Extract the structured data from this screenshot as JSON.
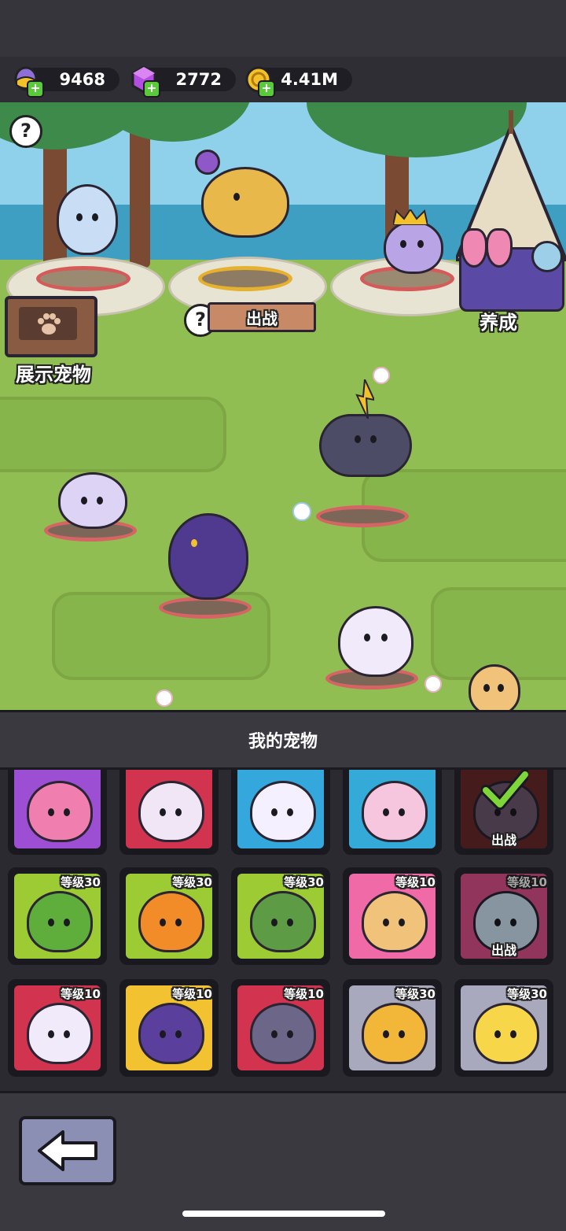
{
  "currencies": [
    {
      "name": "egg",
      "value": "9468",
      "icon": "egg-icon",
      "color": "#8e6fd8"
    },
    {
      "name": "gem",
      "value": "2772",
      "icon": "gem-icon",
      "color": "#b34ee0"
    },
    {
      "name": "coin",
      "value": "4.41M",
      "icon": "coin-icon",
      "color": "#f3c22b"
    }
  ],
  "scene": {
    "help_label": "?",
    "deploy_button": "出战",
    "display_pets_label": "展示宠物",
    "cultivate_label": "养成"
  },
  "panel": {
    "title": "我的宠物"
  },
  "pets": [
    {
      "bg": "#9c4fd3",
      "level": "",
      "deployed": false,
      "color": "#f07fb0"
    },
    {
      "bg": "#d2344f",
      "level": "",
      "deployed": false,
      "color": "#f0e6f5"
    },
    {
      "bg": "#34a7dc",
      "level": "",
      "deployed": false,
      "color": "#f5f0ff"
    },
    {
      "bg": "#33aad8",
      "level": "",
      "deployed": false,
      "color": "#f6c6de"
    },
    {
      "bg": "#6a2a2a",
      "level": "",
      "deployed": true,
      "color": "#6f5a70"
    },
    {
      "bg": "#9ccb34",
      "level": "等级30",
      "deployed": false,
      "color": "#5fae3b"
    },
    {
      "bg": "#9ccb34",
      "level": "等级30",
      "deployed": false,
      "color": "#f18c28"
    },
    {
      "bg": "#9ccb34",
      "level": "等级30",
      "deployed": false,
      "color": "#5e9b45"
    },
    {
      "bg": "#ef6aa6",
      "level": "等级10",
      "deployed": false,
      "color": "#f0c27a"
    },
    {
      "bg": "#e0528e",
      "level": "等级10",
      "deployed": true,
      "color": "#cfe5f8"
    },
    {
      "bg": "#d2344f",
      "level": "等级10",
      "deployed": false,
      "color": "#f1eafa"
    },
    {
      "bg": "#f2c230",
      "level": "等级10",
      "deployed": false,
      "color": "#5a3f9c"
    },
    {
      "bg": "#d2344f",
      "level": "等级10",
      "deployed": false,
      "color": "#6c6788"
    },
    {
      "bg": "#a9a9bd",
      "level": "等级30",
      "deployed": false,
      "color": "#f2b738"
    },
    {
      "bg": "#a9a9bd",
      "level": "等级30",
      "deployed": false,
      "color": "#f7d64a"
    }
  ],
  "deployed_tag": "出战"
}
